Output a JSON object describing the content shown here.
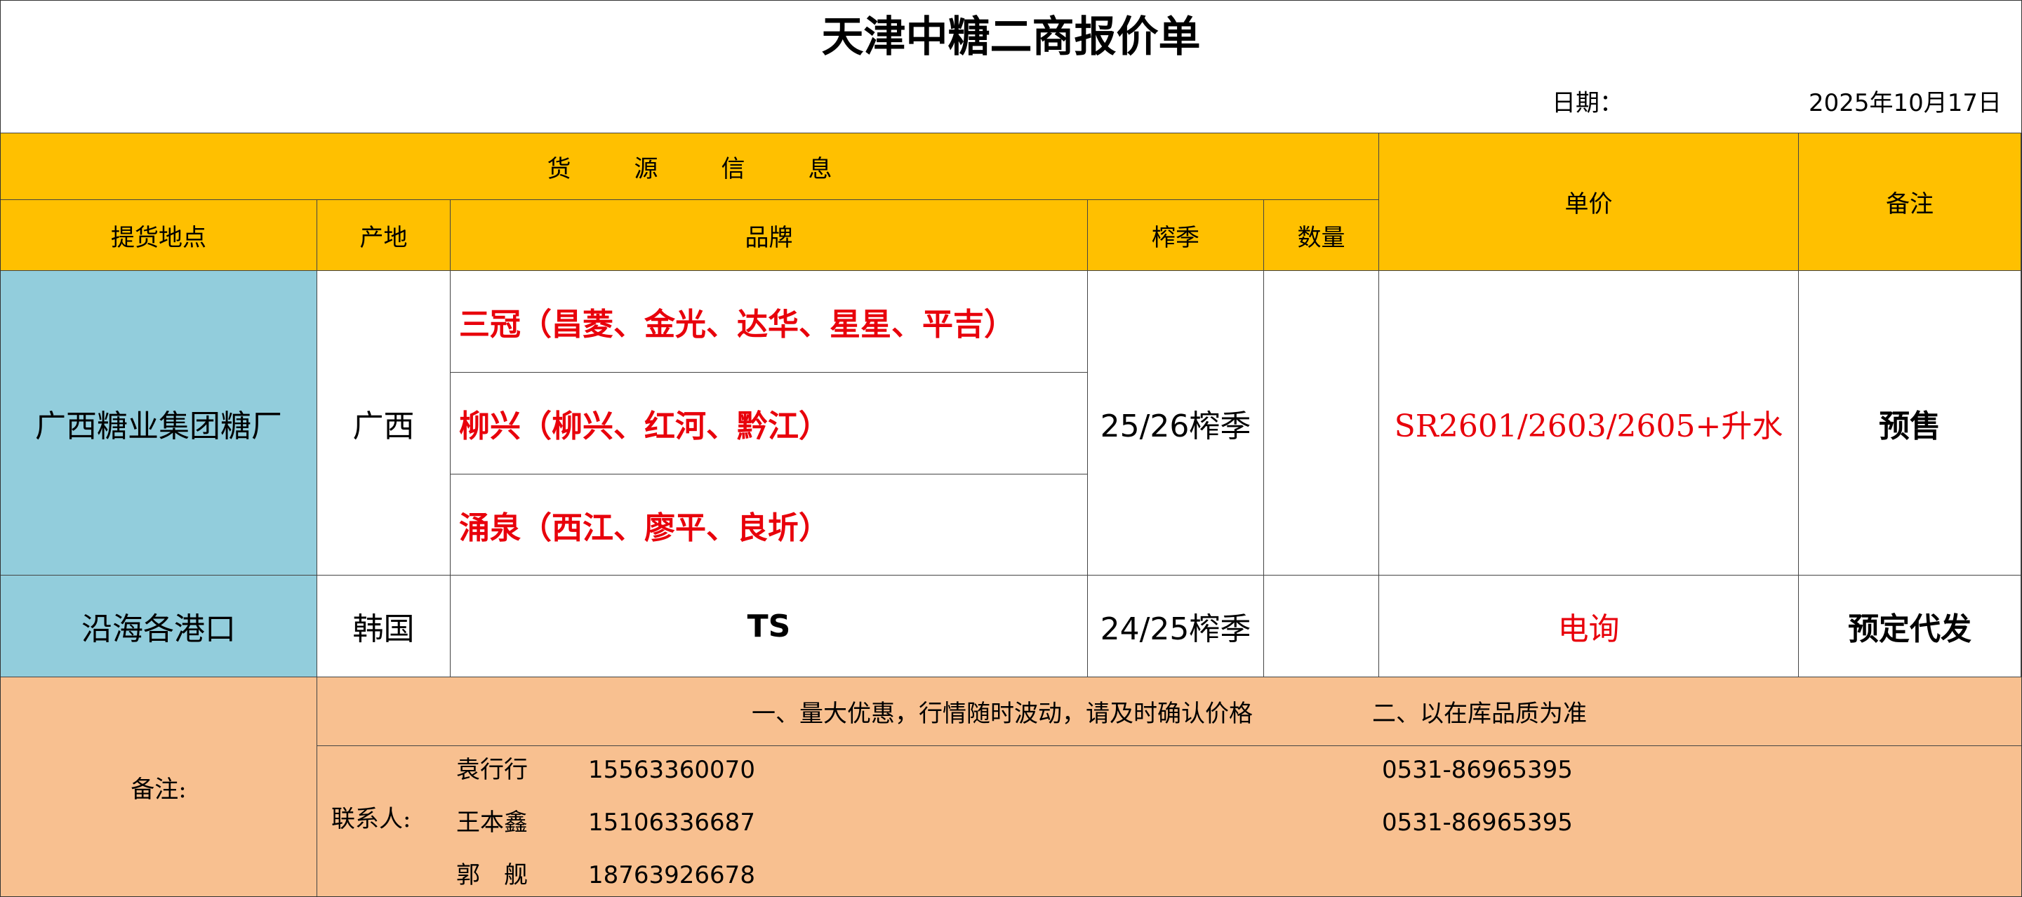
{
  "title": "天津中糖二商报价单",
  "date": {
    "label": "日期：",
    "value": "2025年10月17日"
  },
  "header": {
    "group_label": "货源信息",
    "columns": {
      "location": "提货地点",
      "origin": "产地",
      "brand": "品牌",
      "season": "榨季",
      "quantity": "数量",
      "price": "单价",
      "remark": "备注"
    }
  },
  "rows": [
    {
      "location": "广西糖业集团糖厂",
      "origin": "广西",
      "brands": [
        "三冠（昌菱、金光、达华、星星、平吉）",
        "柳兴（柳兴、红河、黔江）",
        "涌泉（西江、廖平、良圻）"
      ],
      "season": "25/26榨季",
      "quantity": "",
      "price": "SR2601/2603/2605+升水",
      "remark": "预售"
    },
    {
      "location": "沿海各港口",
      "origin": "韩国",
      "brand": "TS",
      "season": "24/25榨季",
      "quantity": "",
      "price": "电询",
      "remark": "预定代发"
    }
  ],
  "footer": {
    "label": "备注:",
    "notice1": "一、量大优惠，行情随时波动，请及时确认价格",
    "notice2": "二、以在库品质为准",
    "contact_label": "联系人:",
    "contacts": [
      {
        "name": "袁行行",
        "mobile": "15563360070",
        "phone": "0531-86965395"
      },
      {
        "name": "王本鑫",
        "mobile": "15106336687",
        "phone": "0531-86965395"
      },
      {
        "name": "郭　舰",
        "mobile": "18763926678",
        "phone": ""
      }
    ]
  },
  "colors": {
    "header": "#ffc000",
    "location": "#92cddc",
    "footer": "#f8c090",
    "price_text": "#e8000b"
  }
}
